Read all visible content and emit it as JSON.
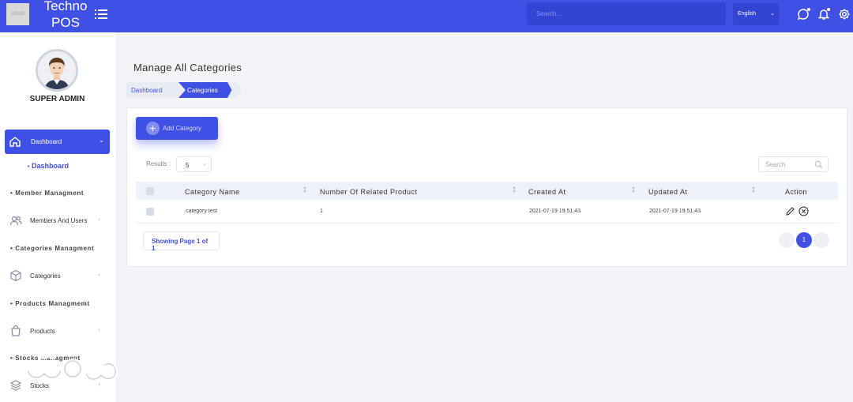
{
  "brand": {
    "logo_text": "LOGO",
    "line1": "Techno",
    "line2": "POS"
  },
  "topbar": {
    "search_placeholder": "Search...",
    "language": "English",
    "icons": [
      "menu-icon",
      "chat-icon",
      "bell-icon",
      "gear-icon"
    ]
  },
  "sidebar": {
    "user_name": "SUPER ADMIN",
    "dashboard_label": "Dashboard",
    "dashboard_sub": "Dashboard",
    "sections": [
      {
        "title": "Member Managment",
        "item": "Members And Users",
        "icon": "users-icon"
      },
      {
        "title": "Categories Managment",
        "item": "Categories",
        "icon": "box-icon"
      },
      {
        "title": "Products Managmemt",
        "item": "Products",
        "icon": "bag-icon"
      },
      {
        "title": "Stocks Managment",
        "item": "Stocks",
        "icon": "layers-icon"
      }
    ]
  },
  "page": {
    "title": "Manage All Categories",
    "breadcrumb": [
      "Dashboard",
      "Categories"
    ],
    "add_button": "Add Category",
    "results_label": "Results :",
    "results_value": "5",
    "search_placeholder": "Search",
    "table": {
      "columns": [
        "Category Name",
        "Number Of Related Product",
        "Created At",
        "Updated At",
        "Action"
      ],
      "rows": [
        {
          "name": "category test",
          "count": "1",
          "created": "2021-07-19 19:51:43",
          "updated": "2021-07-19 19:51:43"
        }
      ]
    },
    "showing": "Showing Page 1 of 1",
    "pager": {
      "prev": "‹",
      "current": "1",
      "next": "›"
    }
  },
  "colors": {
    "primary": "#3f51e4",
    "background": "#f3f4f8"
  }
}
